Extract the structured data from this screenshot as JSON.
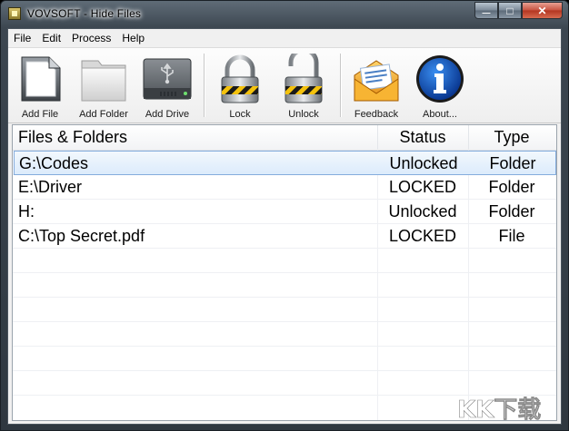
{
  "window": {
    "title": "VOVSOFT - Hide Files",
    "buttons": {
      "minimize": "—",
      "maximize": "□",
      "close": "✕"
    }
  },
  "menu": [
    "File",
    "Edit",
    "Process",
    "Help"
  ],
  "toolbar": {
    "items": [
      {
        "label": "Add File",
        "icon": "file-icon"
      },
      {
        "label": "Add Folder",
        "icon": "folder-icon"
      },
      {
        "label": "Add Drive",
        "icon": "drive-icon"
      },
      {
        "label": "Lock",
        "icon": "lock-closed-icon"
      },
      {
        "label": "Unlock",
        "icon": "lock-open-icon"
      },
      {
        "label": "Feedback",
        "icon": "mail-icon"
      },
      {
        "label": "About...",
        "icon": "info-icon"
      }
    ]
  },
  "list": {
    "columns": [
      "Files & Folders",
      "Status",
      "Type"
    ],
    "rows": [
      {
        "path": "G:\\Codes",
        "status": "Unlocked",
        "type": "Folder",
        "selected": true
      },
      {
        "path": "E:\\Driver",
        "status": "LOCKED",
        "type": "Folder"
      },
      {
        "path": "H:",
        "status": "Unlocked",
        "type": "Folder"
      },
      {
        "path": "C:\\Top Secret.pdf",
        "status": "LOCKED",
        "type": "File"
      }
    ]
  },
  "watermark": "KK下载",
  "colors": {
    "selection": "#dcebfb",
    "selection_border": "#84acdd",
    "close_button": "#c7513e"
  }
}
